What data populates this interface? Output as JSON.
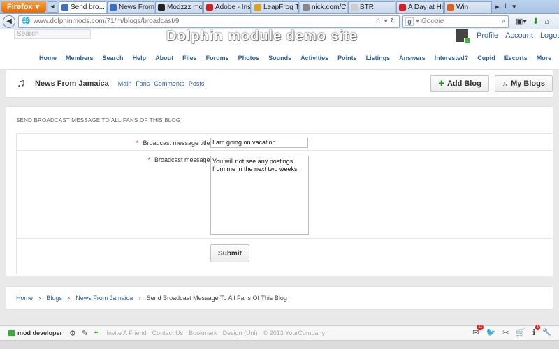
{
  "browser": {
    "menu_label": "Firefox",
    "tabs": [
      {
        "label": "Send bro...",
        "fav_color": "#3a6fc4",
        "active": true
      },
      {
        "label": "News From ...",
        "fav_color": "#3a6fc4",
        "active": false
      },
      {
        "label": "Modzzz mo...",
        "fav_color": "#222222",
        "active": false
      },
      {
        "label": "Adobe - Ins...",
        "fav_color": "#d42020",
        "active": false
      },
      {
        "label": "LeapFrog T...",
        "fav_color": "#e0a020",
        "active": false
      },
      {
        "label": "nick.com/C...",
        "fav_color": "#888888",
        "active": false
      },
      {
        "label": "BTR",
        "fav_color": "#cccccc",
        "active": false
      },
      {
        "label": "A Day at Hi...",
        "fav_color": "#d42020",
        "active": false
      },
      {
        "label": "Win",
        "fav_color": "#e06020",
        "active": false
      }
    ],
    "url": "www.dolphinmods.com/71/m/blogs/broadcast/9",
    "search_placeholder": "Google"
  },
  "site": {
    "search_placeholder": "Search",
    "title": "Dolphin module demo site",
    "user_links": [
      "Profile",
      "Account",
      "Logou"
    ],
    "nav": [
      "Home",
      "Members",
      "Search",
      "Help",
      "About",
      "Files",
      "Forums",
      "Photos",
      "Sounds",
      "Activities",
      "Points",
      "Listings",
      "Answers",
      "Interested?",
      "Cupid",
      "Escorts",
      "More"
    ]
  },
  "blog": {
    "name": "News From Jamaica",
    "links": [
      "Main",
      "Fans",
      "Comments",
      "Posts"
    ],
    "add_blog": "Add Blog",
    "my_blogs": "My Blogs"
  },
  "form": {
    "heading": "SEND BROADCAST MESSAGE TO ALL FANS OF THIS BLOG",
    "title_label": "Broadcast message title:",
    "title_value": "I am going on vacation",
    "message_label": "Broadcast message:",
    "message_value": "You will not see any postings from me in the next two weeks",
    "required_mark": "*",
    "submit": "Submit"
  },
  "breadcrumb": {
    "items": [
      "Home",
      "Blogs",
      "News From Jamaica"
    ],
    "current": "Send Broadcast Message To All Fans Of This Blog",
    "separator": "›"
  },
  "footer": {
    "user": "mod developer",
    "links": [
      "Invite A Friend",
      "Contact Us",
      "Bookmark",
      "Design (Uni)",
      "© 2013 YourCompany"
    ],
    "mail_count": "11",
    "info_count": "1"
  }
}
